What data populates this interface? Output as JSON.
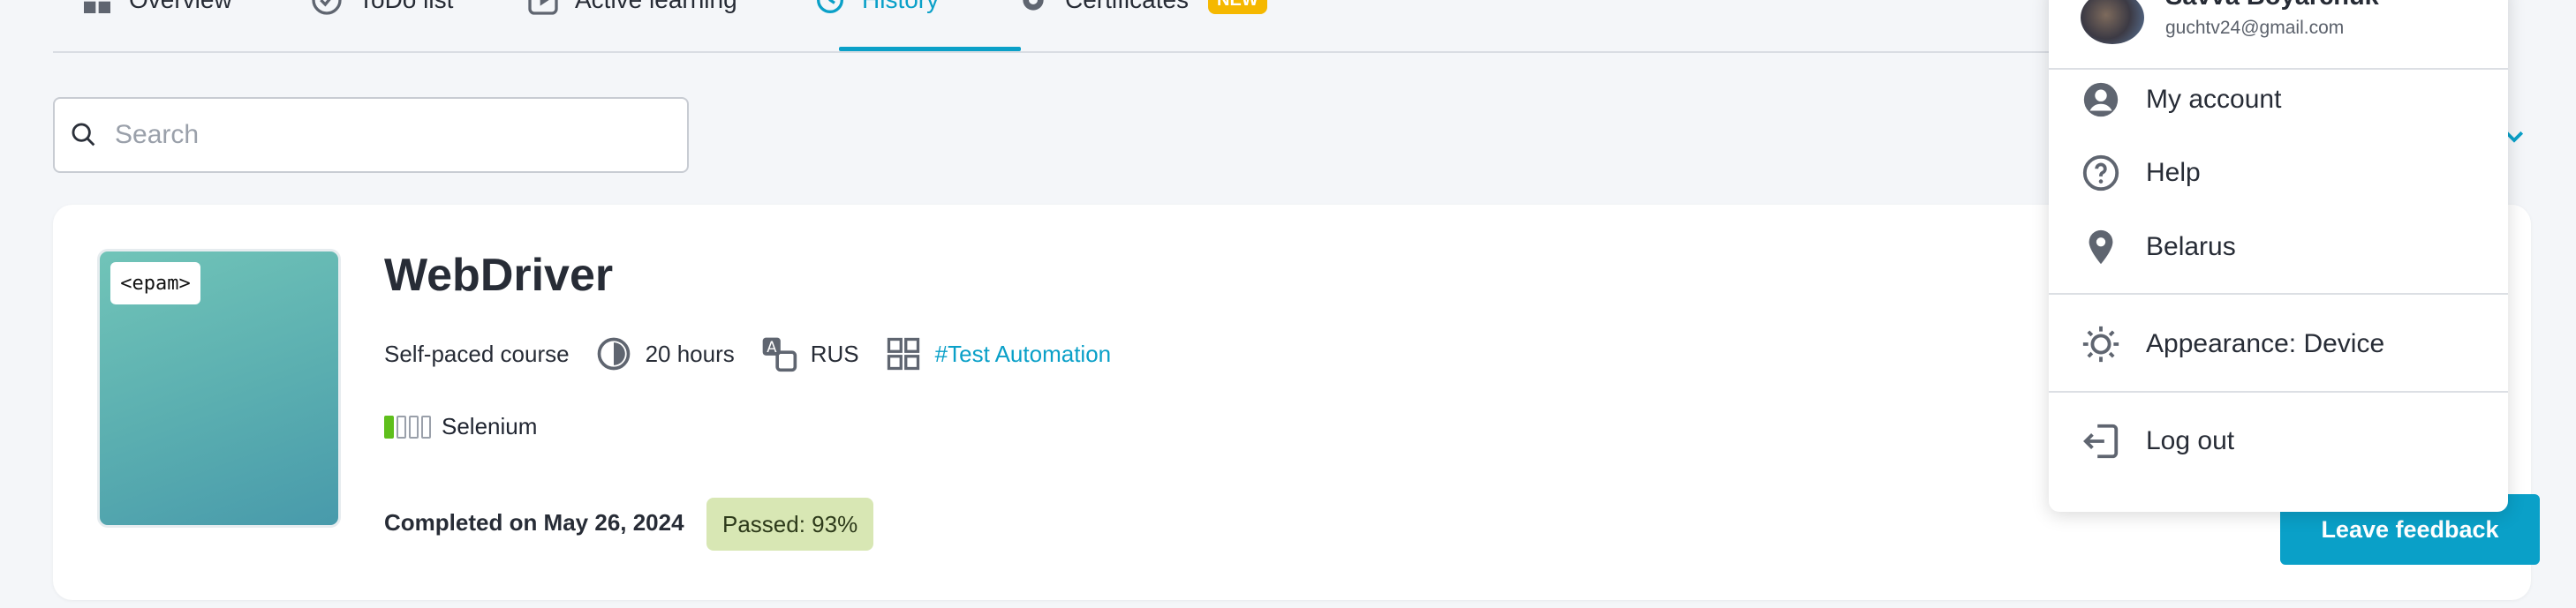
{
  "nav": {
    "tabs": [
      {
        "label": "Overview",
        "icon": "grid-icon"
      },
      {
        "label": "ToDo list",
        "icon": "check-circle-icon"
      },
      {
        "label": "Active learning",
        "icon": "play-square-icon"
      },
      {
        "label": "History",
        "icon": "history-icon"
      },
      {
        "label": "Certificates",
        "icon": "gear-icon"
      }
    ],
    "active_tab": "History",
    "new_badge": "NEW",
    "accent_color": "#0aa0c8"
  },
  "search": {
    "placeholder": "Search",
    "value": ""
  },
  "course": {
    "title": "WebDriver",
    "logo_text": "<epam>",
    "type": "Self-paced course",
    "duration": "20 hours",
    "language": "RUS",
    "tag": "#Test Automation",
    "skill": "Selenium",
    "skill_level": {
      "filled": 1,
      "total": 4
    },
    "completed": "Completed on May 26, 2024",
    "passed": "Passed: 93%",
    "feedback_label": "Leave feedback"
  },
  "account_menu": {
    "user_name": "Savva Boyarchuk",
    "user_email": "guchtv24@gmail.com",
    "items": [
      {
        "label": "My account",
        "icon": "user-circle-icon"
      },
      {
        "label": "Help",
        "icon": "question-circle-icon"
      },
      {
        "label": "Belarus",
        "icon": "location-pin-icon"
      },
      {
        "label": "Appearance: Device",
        "icon": "sun-icon"
      },
      {
        "label": "Log out",
        "icon": "logout-icon"
      }
    ]
  }
}
